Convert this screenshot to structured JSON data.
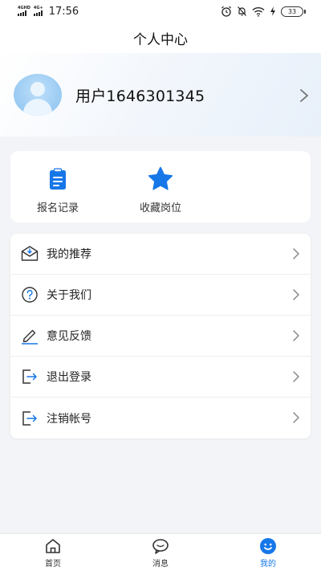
{
  "status_bar": {
    "network_1": "4GHD",
    "network_2": "4G+",
    "time": "17:56",
    "battery": "33"
  },
  "page_title": "个人中心",
  "profile": {
    "username": "用户1646301345"
  },
  "quick_actions": [
    {
      "label": "报名记录",
      "icon": "clipboard-icon"
    },
    {
      "label": "收藏岗位",
      "icon": "star-icon"
    }
  ],
  "menu": [
    {
      "label": "我的推荐",
      "icon": "inbox-icon"
    },
    {
      "label": "关于我们",
      "icon": "question-circle-icon"
    },
    {
      "label": "意见反馈",
      "icon": "pen-icon"
    },
    {
      "label": "退出登录",
      "icon": "logout-icon"
    },
    {
      "label": "注销帐号",
      "icon": "logout-icon"
    }
  ],
  "tabs": [
    {
      "label": "首页",
      "icon": "home-icon"
    },
    {
      "label": "消息",
      "icon": "chat-icon"
    },
    {
      "label": "我的",
      "icon": "smile-icon",
      "active": true
    }
  ],
  "colors": {
    "accent": "#1677e8",
    "background": "#f2f4f7"
  }
}
